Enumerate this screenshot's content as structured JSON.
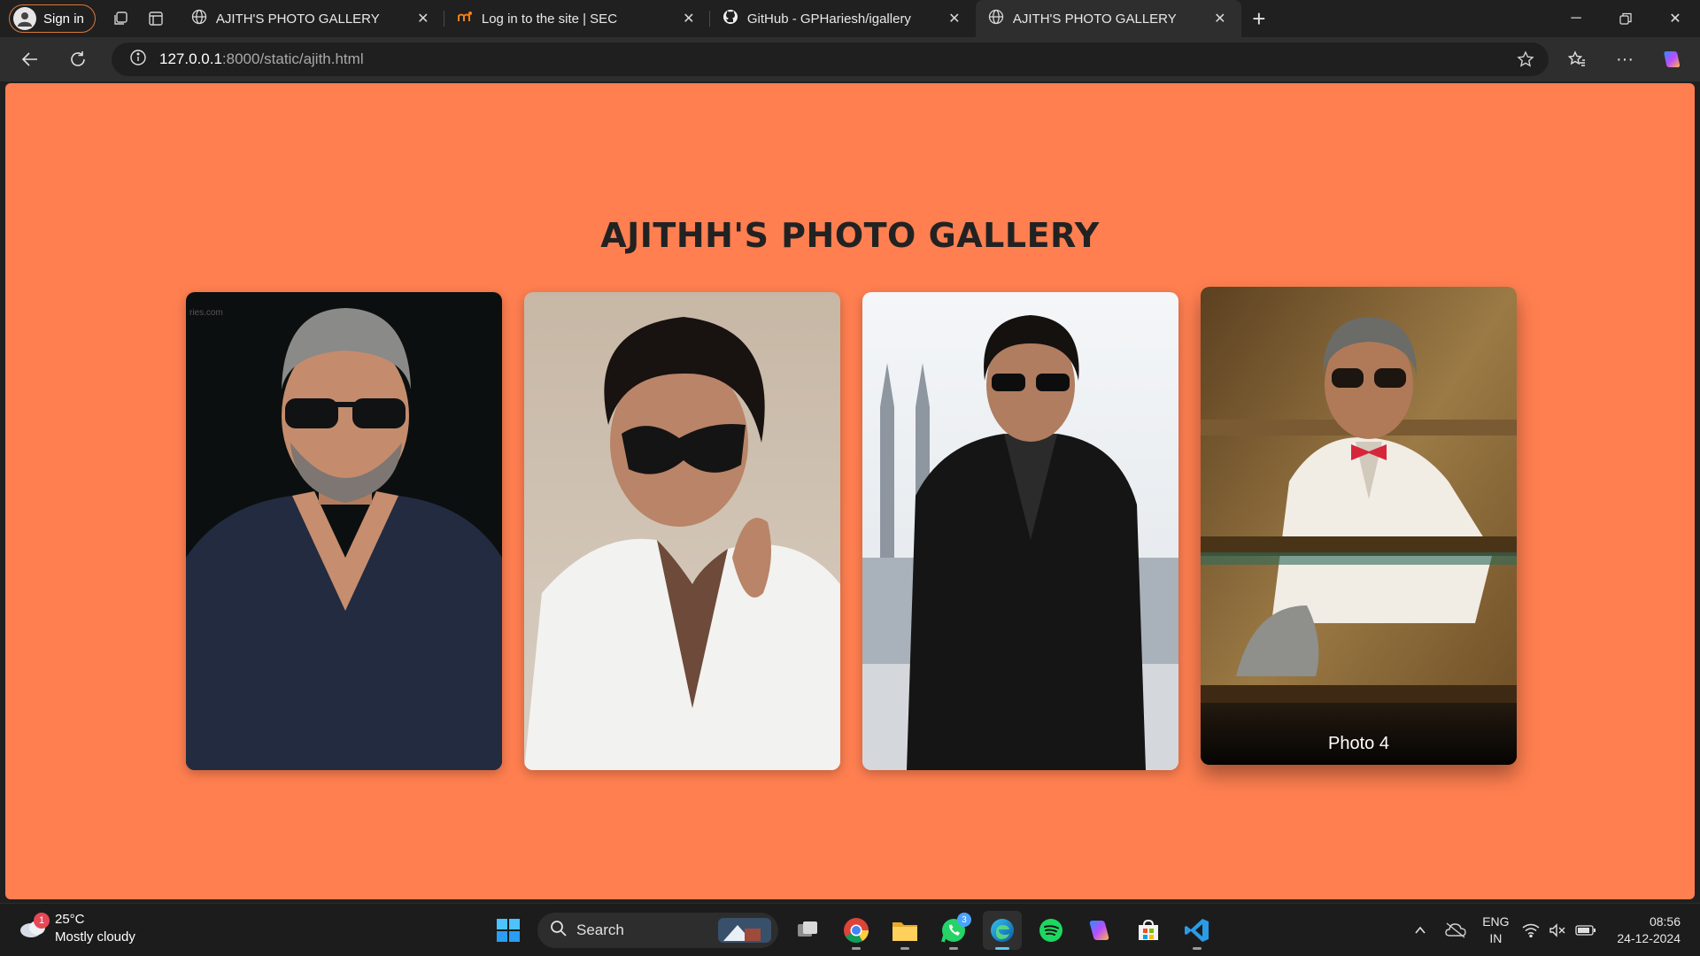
{
  "browser": {
    "signin_label": "Sign in",
    "tabs": [
      {
        "title": "AJITH'S PHOTO GALLERY",
        "icon": "globe-icon",
        "active": false
      },
      {
        "title": "Log in to the site | SEC",
        "icon": "moodle-icon",
        "active": false
      },
      {
        "title": "GitHub - GPHariesh/igallery",
        "icon": "github-icon",
        "active": false
      },
      {
        "title": "AJITH'S PHOTO GALLERY",
        "icon": "globe-icon",
        "active": true
      }
    ],
    "url_host": "127.0.0.1",
    "url_path": ":8000/static/ajith.html"
  },
  "page": {
    "title": "AJITHH'S PHOTO GALLERY",
    "photos": [
      {
        "alt": "Photo 1",
        "caption": ""
      },
      {
        "alt": "Photo 2",
        "caption": ""
      },
      {
        "alt": "Photo 3",
        "caption": ""
      },
      {
        "alt": "Photo 4",
        "caption": "Photo 4",
        "hovered": true
      }
    ],
    "background_color": "#ff7f50"
  },
  "taskbar": {
    "weather_temp": "25°C",
    "weather_desc": "Mostly cloudy",
    "weather_badge": "1",
    "search_label": "Search",
    "whatsapp_badge": "3",
    "lang_line1": "ENG",
    "lang_line2": "IN",
    "time": "08:56",
    "date": "24-12-2024"
  }
}
